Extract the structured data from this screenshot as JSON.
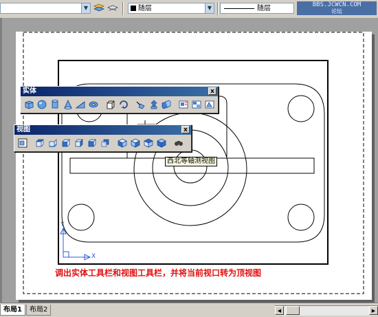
{
  "toolbar": {
    "layer_value": "",
    "color_value": "随层",
    "linetype_value": "随层",
    "watermark": "BBS.JCWCN.COM",
    "watermark_sub": "论坛"
  },
  "palettes": {
    "solids": {
      "title": "实体",
      "close_label": "x",
      "tools": [
        "box-icon",
        "sphere-icon",
        "cylinder-icon",
        "cone-icon",
        "wedge-icon",
        "torus-icon",
        "extrude-icon",
        "revolve-icon",
        "slice-icon",
        "section-icon",
        "interfere-icon",
        "setup-drawing-icon",
        "setup-view-icon",
        "setup-profile-icon"
      ]
    },
    "views": {
      "title": "视图",
      "close_label": "x",
      "tools": [
        "named-views-icon",
        "top-view-icon",
        "bottom-view-icon",
        "left-view-icon",
        "right-view-icon",
        "front-view-icon",
        "back-view-icon",
        "sw-iso-icon",
        "se-iso-icon",
        "ne-iso-icon",
        "nw-iso-icon",
        "camera-icon"
      ]
    }
  },
  "tooltip": "西北等轴测视图",
  "instruction": "调出实体工具栏和视图工具栏，并将当前视口转为顶视图",
  "ucs": {
    "x_label": "X",
    "y_label": "Y"
  },
  "tabs": [
    {
      "label": "布局1",
      "active": true
    },
    {
      "label": "布局2",
      "active": false
    }
  ],
  "colors": {
    "title_bar": "#0a246a",
    "instruction": "#e01010",
    "tooltip_bg": "#ffffe1",
    "paper": "#ffffff",
    "workspace": "#a0a0a0"
  }
}
